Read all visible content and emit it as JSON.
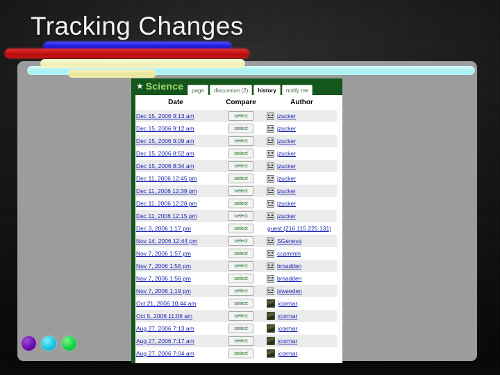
{
  "slide": {
    "title": "Tracking Changes"
  },
  "decor": {
    "bars": [
      "blue",
      "red",
      "cyan",
      "cream",
      "yellow"
    ],
    "dots": [
      "purple",
      "cyan",
      "green"
    ],
    "colors": {
      "blue": "#1414d8",
      "red": "#b90d0d",
      "cyan": "#a6f0ef",
      "cream": "#eef0b6",
      "yellow": "#e9e59b",
      "dot_purple": "#6a10b0",
      "dot_cyan": "#17c6e8",
      "dot_green": "#16d44a",
      "panel_gray": "#9c9c9c",
      "brand_green": "#14561c",
      "brand_text_green": "#9ed96b",
      "link_blue": "#1b24b5",
      "select_green": "#1d6b1d"
    }
  },
  "wiki": {
    "brand": {
      "star_icon": "star-icon",
      "name": "Science"
    },
    "tabs": [
      {
        "label": "page",
        "active": false
      },
      {
        "label": "discussion (2)",
        "active": false
      },
      {
        "label": "history",
        "active": true
      },
      {
        "label": "notify me",
        "active": false
      }
    ],
    "table": {
      "headers": {
        "date": "Date",
        "compare": "Compare",
        "author": "Author"
      },
      "select_label": "select",
      "rows": [
        {
          "date": "Dec 15, 2006 9:13 am",
          "author": "jzucker",
          "avatar": "sad-face-avatar"
        },
        {
          "date": "Dec 15, 2006 9:12 am",
          "author": "jzucker",
          "avatar": "sad-face-avatar"
        },
        {
          "date": "Dec 15, 2006 9:09 am",
          "author": "jzucker",
          "avatar": "sad-face-avatar"
        },
        {
          "date": "Dec 15, 2006 8:52 am",
          "author": "jzucker",
          "avatar": "sad-face-avatar"
        },
        {
          "date": "Dec 15, 2006 8:34 am",
          "author": "jzucker",
          "avatar": "sad-face-avatar"
        },
        {
          "date": "Dec 11, 2006 12:45 pm",
          "author": "jzucker",
          "avatar": "sad-face-avatar"
        },
        {
          "date": "Dec 11, 2006 12:39 pm",
          "author": "jzucker",
          "avatar": "sad-face-avatar"
        },
        {
          "date": "Dec 11, 2006 12:28 pm",
          "author": "jzucker",
          "avatar": "sad-face-avatar"
        },
        {
          "date": "Dec 11, 2006 12:15 pm",
          "author": "jzucker",
          "avatar": "sad-face-avatar"
        },
        {
          "date": "Dec 3, 2006 1:17 pm",
          "author": "guest (216.115.225.131)",
          "avatar": "none"
        },
        {
          "date": "Nov 14, 2006 12:44 pm",
          "author": "SGeneva",
          "avatar": "sad-face-avatar"
        },
        {
          "date": "Nov 7, 2006 1:57 pm",
          "author": "ccammin",
          "avatar": "sad-face-avatar"
        },
        {
          "date": "Nov 7, 2006 1:56 pm",
          "author": "bmadden",
          "avatar": "sad-face-avatar"
        },
        {
          "date": "Nov 7, 2006 1:56 pm",
          "author": "bmadden",
          "avatar": "sad-face-avatar"
        },
        {
          "date": "Nov 7, 2006 1:19 pm",
          "author": "jsweeden",
          "avatar": "sad-face-avatar"
        },
        {
          "date": "Oct 21, 2006 10:44 am",
          "author": "jcormar",
          "avatar": "photo-avatar"
        },
        {
          "date": "Oct 5, 2006 11:06 am",
          "author": "jcormar",
          "avatar": "photo-avatar"
        },
        {
          "date": "Aug 27, 2006 7:13 am",
          "author": "jcormar",
          "avatar": "photo-avatar"
        },
        {
          "date": "Aug 27, 2006 7:17 am",
          "author": "jcormar",
          "avatar": "photo-avatar"
        },
        {
          "date": "Aug 27, 2006 7:04 am",
          "author": "jcormar",
          "avatar": "photo-avatar"
        }
      ]
    }
  }
}
